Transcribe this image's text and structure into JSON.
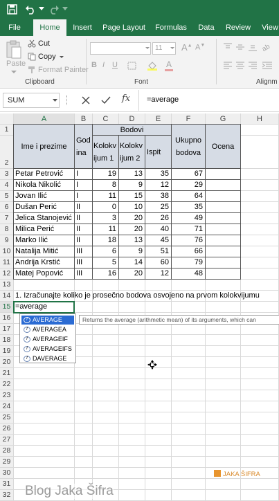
{
  "app": {
    "name": "Microsoft Excel",
    "accent": "#217346"
  },
  "tabs": [
    "File",
    "Home",
    "Insert",
    "Page Layout",
    "Formulas",
    "Data",
    "Review",
    "View"
  ],
  "active_tab": "Home",
  "clipboard": {
    "cut": "Cut",
    "copy": "Copy",
    "paste": "Paste",
    "format_painter": "Format Painter",
    "group": "Clipboard"
  },
  "font": {
    "size": "11",
    "group": "Font"
  },
  "alignment": {
    "group": "Alignm"
  },
  "formula_bar": {
    "name_box": "SUM",
    "formula": "=average"
  },
  "columns": [
    "A",
    "B",
    "C",
    "D",
    "E",
    "F",
    "G",
    "H"
  ],
  "rows": [
    "1",
    "2",
    "3",
    "4",
    "5",
    "6",
    "7",
    "8",
    "9",
    "10",
    "11",
    "12",
    "13",
    "14",
    "15",
    "16",
    "17",
    "18",
    "19",
    "20",
    "21",
    "22",
    "23",
    "24",
    "25",
    "26",
    "27",
    "28",
    "29",
    "30",
    "31",
    "32"
  ],
  "table": {
    "header_name": "Ime i prezime",
    "header_year": "God ina",
    "header_points": "Bodovi",
    "header_k1": "Kolokv ijum 1",
    "header_k2": "Kolokv ijum 2",
    "header_exam": "Ispit",
    "header_total": "Ukupno bodova",
    "header_grade": "Ocena",
    "students": [
      {
        "name": "Petar Petrović",
        "year": "I",
        "k1": "19",
        "k2": "13",
        "exam": "35",
        "total": "67"
      },
      {
        "name": "Nikola Nikolić",
        "year": "I",
        "k1": "8",
        "k2": "9",
        "exam": "12",
        "total": "29"
      },
      {
        "name": "Jovan Ilić",
        "year": "I",
        "k1": "11",
        "k2": "15",
        "exam": "38",
        "total": "64"
      },
      {
        "name": "Dušan Perić",
        "year": "II",
        "k1": "0",
        "k2": "10",
        "exam": "25",
        "total": "35"
      },
      {
        "name": "Jelica Stanojević",
        "year": "II",
        "k1": "3",
        "k2": "20",
        "exam": "26",
        "total": "49"
      },
      {
        "name": "Milica Perić",
        "year": "II",
        "k1": "11",
        "k2": "20",
        "exam": "40",
        "total": "71"
      },
      {
        "name": "Marko Ilić",
        "year": "II",
        "k1": "18",
        "k2": "13",
        "exam": "45",
        "total": "76"
      },
      {
        "name": "Natalija Mitić",
        "year": "III",
        "k1": "6",
        "k2": "9",
        "exam": "51",
        "total": "66"
      },
      {
        "name": "Andrija Krstić",
        "year": "III",
        "k1": "5",
        "k2": "14",
        "exam": "60",
        "total": "79"
      },
      {
        "name": "Matej Popović",
        "year": "III",
        "k1": "16",
        "k2": "20",
        "exam": "12",
        "total": "48"
      }
    ]
  },
  "task_text": "1. Izračunajte koliko je prosečno bodova osvojeno na prvom kolokvijumu",
  "active_cell_value": "=average",
  "autocomplete": [
    "AVERAGE",
    "AVERAGEA",
    "AVERAGEIF",
    "AVERAGEIFS",
    "DAVERAGE"
  ],
  "tooltip": "Returns the average (arithmetic mean) of its arguments, which can",
  "watermark": {
    "logo": "JAKA ŠIFRA",
    "blog": "Blog Jaka Šifra"
  }
}
